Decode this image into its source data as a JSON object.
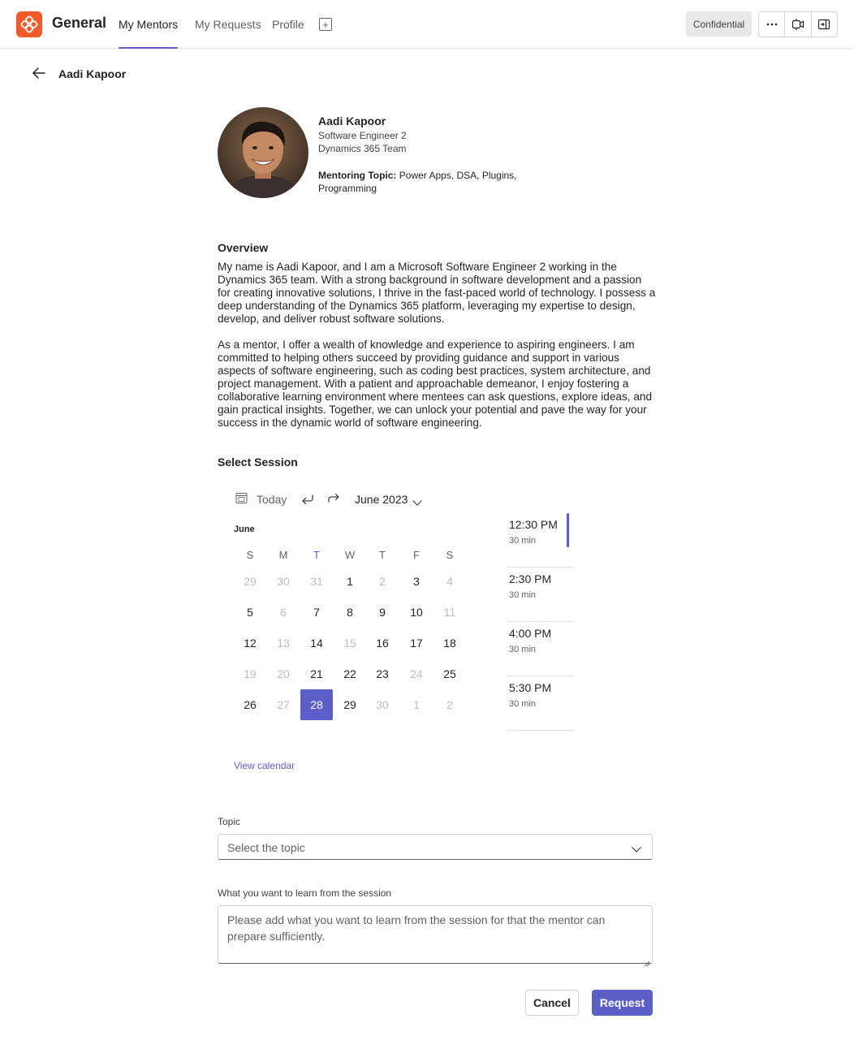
{
  "app": {
    "title": "General",
    "logo_icon": "app-logo-icon",
    "tabs": [
      {
        "label": "My Mentors",
        "active": true
      },
      {
        "label": "My Requests",
        "active": false
      },
      {
        "label": "Profile",
        "active": false
      }
    ],
    "add_tab_icon": "add-tab-icon",
    "confidential_label": "Confidential",
    "actions": [
      "more-options-icon",
      "meet-now-icon",
      "popout-icon"
    ]
  },
  "header": {
    "back_icon": "back-arrow-icon",
    "title": "Aadi Kapoor"
  },
  "profile": {
    "name": "Aadi Kapoor",
    "role": "Software Engineer 2",
    "team": "Dynamics 365 Team",
    "topic_label": "Mentoring Topic:",
    "topic_value": "Power Apps, DSA, Plugins, Programming"
  },
  "overview": {
    "heading": "Overview",
    "paragraph1": "My name is Aadi Kapoor, and I am a Microsoft Software Engineer 2 working in the Dynamics 365 team. With a strong background in software development and a passion for creating innovative solutions, I thrive in the fast-paced world of technology. I possess a deep understanding of the Dynamics 365 platform, leveraging my expertise to design, develop, and deliver robust software solutions.",
    "paragraph2": "As a mentor, I offer a wealth of knowledge and experience to aspiring engineers. I am committed to helping others succeed by providing guidance and support in various aspects of software engineering, such as coding best practices, system architecture, and project management. With a patient and approachable demeanor, I enjoy fostering a collaborative learning environment where mentees can ask questions, explore ideas, and gain practical insights. Together, we can unlock your potential and pave the way for your success in the dynamic world of software engineering."
  },
  "session": {
    "heading": "Select Session",
    "today_label": "Today",
    "month_selector": "June 2023",
    "month_label": "June",
    "weekdays": [
      "S",
      "M",
      "T",
      "W",
      "T",
      "F",
      "S"
    ],
    "today_weekday_index": 2,
    "weeks": [
      [
        {
          "d": "29",
          "m": true
        },
        {
          "d": "30",
          "m": true
        },
        {
          "d": "31",
          "m": true
        },
        {
          "d": "1",
          "m": false
        },
        {
          "d": "2",
          "m": true
        },
        {
          "d": "3",
          "m": false
        },
        {
          "d": "4",
          "m": true
        }
      ],
      [
        {
          "d": "5",
          "m": false
        },
        {
          "d": "6",
          "m": true
        },
        {
          "d": "7",
          "m": false
        },
        {
          "d": "8",
          "m": false
        },
        {
          "d": "9",
          "m": false
        },
        {
          "d": "10",
          "m": false
        },
        {
          "d": "11",
          "m": true
        }
      ],
      [
        {
          "d": "12",
          "m": false
        },
        {
          "d": "13",
          "m": true
        },
        {
          "d": "14",
          "m": false
        },
        {
          "d": "15",
          "m": true
        },
        {
          "d": "16",
          "m": false
        },
        {
          "d": "17",
          "m": false
        },
        {
          "d": "18",
          "m": false
        }
      ],
      [
        {
          "d": "19",
          "m": true
        },
        {
          "d": "20",
          "m": true
        },
        {
          "d": "21",
          "m": false
        },
        {
          "d": "22",
          "m": false
        },
        {
          "d": "23",
          "m": false
        },
        {
          "d": "24",
          "m": true
        },
        {
          "d": "25",
          "m": false
        }
      ],
      [
        {
          "d": "26",
          "m": false
        },
        {
          "d": "27",
          "m": true
        },
        {
          "d": "28",
          "m": false,
          "selected": true
        },
        {
          "d": "29",
          "m": false
        },
        {
          "d": "30",
          "m": true
        },
        {
          "d": "1",
          "m": true
        },
        {
          "d": "2",
          "m": true
        }
      ]
    ],
    "time_slots": [
      {
        "time": "12:30 PM",
        "duration": "30 min",
        "selected": true
      },
      {
        "time": "2:30 PM",
        "duration": "30 min",
        "selected": false
      },
      {
        "time": "4:00 PM",
        "duration": "30 min",
        "selected": false
      },
      {
        "time": "5:30 PM",
        "duration": "30 min",
        "selected": false
      }
    ],
    "view_calendar": "View calendar"
  },
  "form": {
    "topic_label": "Topic",
    "topic_placeholder": "Select the topic",
    "learn_label": "What you want to learn from the session",
    "learn_placeholder": "Please add what you want to learn from the session for that the mentor can prepare sufficiently.",
    "cancel_label": "Cancel",
    "request_label": "Request"
  },
  "colors": {
    "accent": "#5b5fc7",
    "brand": "#f15a29"
  }
}
